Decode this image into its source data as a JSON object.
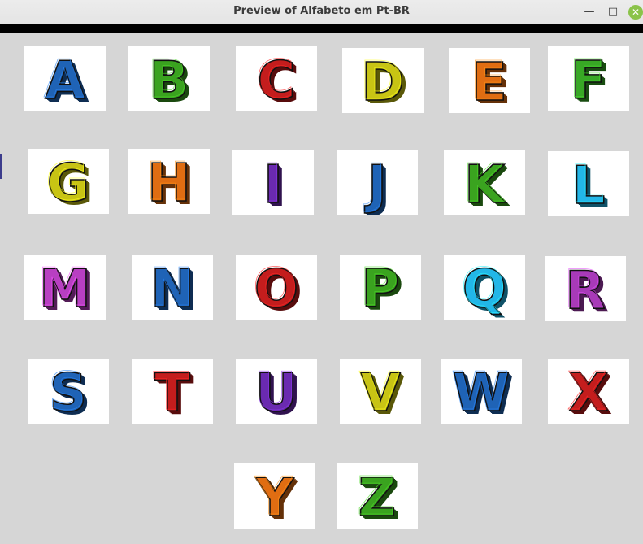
{
  "window": {
    "title": "Preview of Alfabeto em Pt-BR",
    "minimize_icon": "minimize-icon",
    "maximize_icon": "maximize-icon",
    "close_icon": "close-icon"
  },
  "letters": [
    {
      "char": "A",
      "color": "#1f63b6"
    },
    {
      "char": "B",
      "color": "#3aa31f"
    },
    {
      "char": "C",
      "color": "#c41d1d"
    },
    {
      "char": "D",
      "color": "#c8c414"
    },
    {
      "char": "E",
      "color": "#e06d12"
    },
    {
      "char": "F",
      "color": "#38a825"
    },
    {
      "char": "G",
      "color": "#c8c414"
    },
    {
      "char": "H",
      "color": "#e06d12"
    },
    {
      "char": "I",
      "color": "#6a2ab0"
    },
    {
      "char": "J",
      "color": "#1f63b6"
    },
    {
      "char": "K",
      "color": "#3aa31f"
    },
    {
      "char": "L",
      "color": "#22b7e8"
    },
    {
      "char": "M",
      "color": "#b83fc2"
    },
    {
      "char": "N",
      "color": "#1f63b6"
    },
    {
      "char": "O",
      "color": "#c41d1d"
    },
    {
      "char": "P",
      "color": "#3aa31f"
    },
    {
      "char": "Q",
      "color": "#22b7e8"
    },
    {
      "char": "R",
      "color": "#a83ab8"
    },
    {
      "char": "S",
      "color": "#1f63b6"
    },
    {
      "char": "T",
      "color": "#c41d1d"
    },
    {
      "char": "U",
      "color": "#6a2ab0"
    },
    {
      "char": "V",
      "color": "#c8c414"
    },
    {
      "char": "W",
      "color": "#1f63b6"
    },
    {
      "char": "X",
      "color": "#c41d1d"
    },
    {
      "char": "Y",
      "color": "#e06d12"
    },
    {
      "char": "Z",
      "color": "#3aa31f"
    }
  ]
}
